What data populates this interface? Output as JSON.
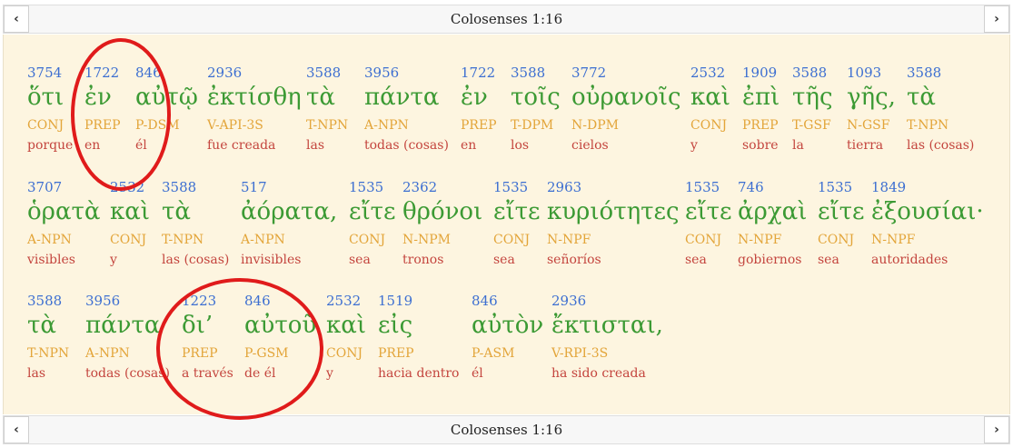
{
  "reference": "Colosenses 1:16",
  "rows": [
    [
      {
        "num": "3754",
        "greek": "ὅτι",
        "morph": "CONJ",
        "gloss": "porque"
      },
      {
        "num": "1722",
        "greek": "ἐν",
        "morph": "PREP",
        "gloss": "en"
      },
      {
        "num": "846",
        "greek": "αὐτῷ",
        "morph": "P-DSM",
        "gloss": "él"
      },
      {
        "num": "2936",
        "greek": "ἐκτίσθη",
        "morph": "V-API-3S",
        "gloss": "fue creada"
      },
      {
        "num": "3588",
        "greek": "τὰ",
        "morph": "T-NPN",
        "gloss": "las"
      },
      {
        "num": "3956",
        "greek": "πάντα",
        "morph": "A-NPN",
        "gloss": "todas (cosas)"
      },
      {
        "num": "1722",
        "greek": "ἐν",
        "morph": "PREP",
        "gloss": "en"
      },
      {
        "num": "3588",
        "greek": "τοῖς",
        "morph": "T-DPM",
        "gloss": "los"
      },
      {
        "num": "3772",
        "greek": "οὐρανοῖς",
        "morph": "N-DPM",
        "gloss": "cielos"
      },
      {
        "num": "2532",
        "greek": "καὶ",
        "morph": "CONJ",
        "gloss": "y"
      },
      {
        "num": "1909",
        "greek": "ἐπὶ",
        "morph": "PREP",
        "gloss": "sobre"
      },
      {
        "num": "3588",
        "greek": "τῆς",
        "morph": "T-GSF",
        "gloss": "la"
      },
      {
        "num": "1093",
        "greek": "γῆς,",
        "morph": "N-GSF",
        "gloss": "tierra"
      },
      {
        "num": "3588",
        "greek": "τὰ",
        "morph": "T-NPN",
        "gloss": "las (cosas)"
      }
    ],
    [
      {
        "num": "3707",
        "greek": "ὁρατὰ",
        "morph": "A-NPN",
        "gloss": "visibles"
      },
      {
        "num": "2532",
        "greek": "καὶ",
        "morph": "CONJ",
        "gloss": "y"
      },
      {
        "num": "3588",
        "greek": "τὰ",
        "morph": "T-NPN",
        "gloss": "las (cosas)"
      },
      {
        "num": "517",
        "greek": "ἀόρατα,",
        "morph": "A-NPN",
        "gloss": "invisibles"
      },
      {
        "num": "1535",
        "greek": "εἴτε",
        "morph": "CONJ",
        "gloss": "sea"
      },
      {
        "num": "2362",
        "greek": "θρόνοι",
        "morph": "N-NPM",
        "gloss": "tronos"
      },
      {
        "num": "1535",
        "greek": "εἴτε",
        "morph": "CONJ",
        "gloss": "sea"
      },
      {
        "num": "2963",
        "greek": "κυριότητες",
        "morph": "N-NPF",
        "gloss": "señoríos"
      },
      {
        "num": "1535",
        "greek": "εἴτε",
        "morph": "CONJ",
        "gloss": "sea"
      },
      {
        "num": "746",
        "greek": "ἀρχαὶ",
        "morph": "N-NPF",
        "gloss": "gobiernos"
      },
      {
        "num": "1535",
        "greek": "εἴτε",
        "morph": "CONJ",
        "gloss": "sea"
      },
      {
        "num": "1849",
        "greek": "ἐξουσίαι·",
        "morph": "N-NPF",
        "gloss": "autoridades"
      }
    ],
    [
      {
        "num": "3588",
        "greek": "τὰ",
        "morph": "T-NPN",
        "gloss": "las"
      },
      {
        "num": "3956",
        "greek": "πάντα",
        "morph": "A-NPN",
        "gloss": "todas (cosas)"
      },
      {
        "num": "1223",
        "greek": "δι’",
        "morph": "PREP",
        "gloss": "a través"
      },
      {
        "num": "846",
        "greek": "αὐτοῦ",
        "morph": "P-GSM",
        "gloss": "de él"
      },
      {
        "num": "2532",
        "greek": "καὶ",
        "morph": "CONJ",
        "gloss": "y"
      },
      {
        "num": "1519",
        "greek": "εἰς",
        "morph": "PREP",
        "gloss": "hacia dentro"
      },
      {
        "num": "846",
        "greek": "αὐτὸν",
        "morph": "P-ASM",
        "gloss": "él"
      },
      {
        "num": "2936",
        "greek": "ἔκτισται,",
        "morph": "V-RPI-3S",
        "gloss": "ha sido creada"
      }
    ]
  ],
  "annotation": {
    "color": "#e01b1b"
  }
}
